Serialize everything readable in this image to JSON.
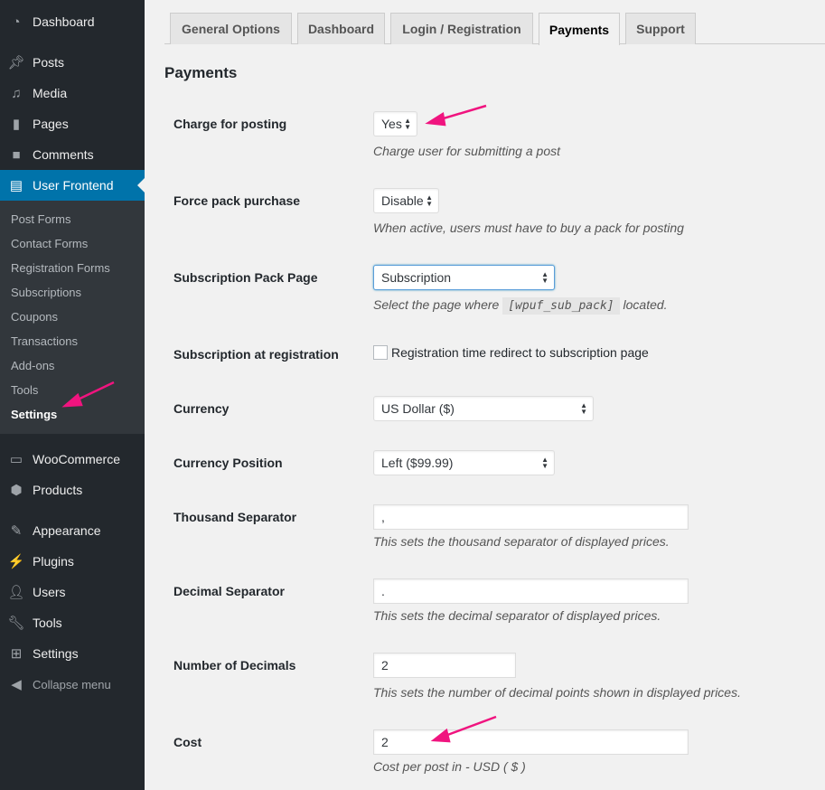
{
  "sidebar": {
    "items": [
      {
        "label": "Dashboard",
        "icon": "dashboard-icon"
      },
      {
        "label": "Posts",
        "icon": "pin-icon"
      },
      {
        "label": "Media",
        "icon": "media-icon"
      },
      {
        "label": "Pages",
        "icon": "pages-icon"
      },
      {
        "label": "Comments",
        "icon": "comment-icon"
      },
      {
        "label": "User Frontend",
        "icon": "frontend-icon"
      },
      {
        "label": "WooCommerce",
        "icon": "woo-icon"
      },
      {
        "label": "Products",
        "icon": "box-icon"
      },
      {
        "label": "Appearance",
        "icon": "brush-icon"
      },
      {
        "label": "Plugins",
        "icon": "plug-icon"
      },
      {
        "label": "Users",
        "icon": "user-icon"
      },
      {
        "label": "Tools",
        "icon": "wrench-icon"
      },
      {
        "label": "Settings",
        "icon": "sliders-icon"
      },
      {
        "label": "Collapse menu",
        "icon": "collapse-icon"
      }
    ],
    "submenu": [
      "Post Forms",
      "Contact Forms",
      "Registration Forms",
      "Subscriptions",
      "Coupons",
      "Transactions",
      "Add-ons",
      "Tools",
      "Settings"
    ]
  },
  "tabs": [
    "General Options",
    "Dashboard",
    "Login / Registration",
    "Payments",
    "Support"
  ],
  "heading": "Payments",
  "rows": {
    "charge": {
      "label": "Charge for posting",
      "value": "Yes",
      "desc": "Charge user for submitting a post"
    },
    "force": {
      "label": "Force pack purchase",
      "value": "Disable",
      "desc": "When active, users must have to buy a pack for posting"
    },
    "subpage": {
      "label": "Subscription Pack Page",
      "value": "Subscription",
      "desc_pre": "Select the page where",
      "code": "[wpuf_sub_pack]",
      "desc_post": "located."
    },
    "subreg": {
      "label": "Subscription at registration",
      "checkbox_label": "Registration time redirect to subscription page",
      "checked": false
    },
    "currency": {
      "label": "Currency",
      "value": "US Dollar ($)"
    },
    "position": {
      "label": "Currency Position",
      "value": "Left ($99.99)"
    },
    "thousand": {
      "label": "Thousand Separator",
      "value": ",",
      "desc": "This sets the thousand separator of displayed prices."
    },
    "decimal": {
      "label": "Decimal Separator",
      "value": ".",
      "desc": "This sets the decimal separator of displayed prices."
    },
    "decimals": {
      "label": "Number of Decimals",
      "value": "2",
      "desc": "This sets the number of decimal points shown in displayed prices."
    },
    "cost": {
      "label": "Cost",
      "value": "2",
      "desc": "Cost per post in - USD ( $ )"
    }
  },
  "colors": {
    "sidebar": "#23282d",
    "active": "#0073aa",
    "arrow": "#f0147f"
  }
}
